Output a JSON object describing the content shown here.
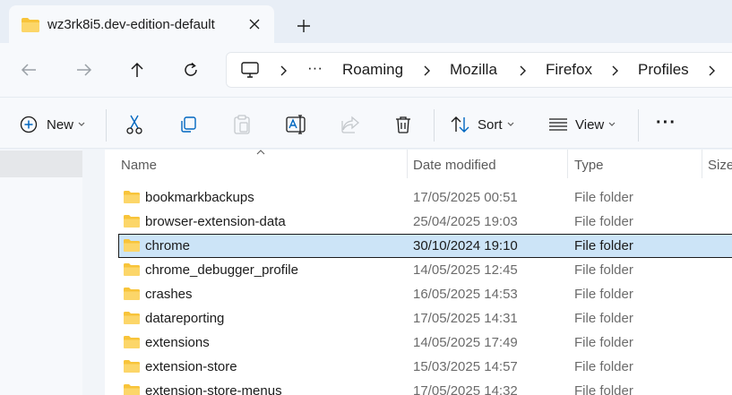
{
  "tab": {
    "title": "wz3rk8i5.dev-edition-default"
  },
  "breadcrumb": [
    "Roaming",
    "Mozilla",
    "Firefox",
    "Profiles"
  ],
  "breadcrumb_overflow": "···",
  "toolbar": {
    "new_label": "New",
    "sort_label": "Sort",
    "view_label": "View",
    "more_label": "···"
  },
  "columns": {
    "name": "Name",
    "date": "Date modified",
    "type": "Type",
    "size": "Size"
  },
  "rows": [
    {
      "name": "bookmarkbackups",
      "date": "17/05/2025 00:51",
      "type": "File folder"
    },
    {
      "name": "browser-extension-data",
      "date": "25/04/2025 19:03",
      "type": "File folder"
    },
    {
      "name": "chrome",
      "date": "30/10/2024 19:10",
      "type": "File folder",
      "selected": true
    },
    {
      "name": "chrome_debugger_profile",
      "date": "14/05/2025 12:45",
      "type": "File folder"
    },
    {
      "name": "crashes",
      "date": "16/05/2025 14:53",
      "type": "File folder"
    },
    {
      "name": "datareporting",
      "date": "17/05/2025 14:31",
      "type": "File folder"
    },
    {
      "name": "extensions",
      "date": "14/05/2025 17:49",
      "type": "File folder"
    },
    {
      "name": "extension-store",
      "date": "15/03/2025 14:57",
      "type": "File folder"
    },
    {
      "name": "extension-store-menus",
      "date": "17/05/2025 14:32",
      "type": "File folder"
    }
  ],
  "colors": {
    "accent": "#0067c0",
    "folder": "#f8c43a",
    "selection": "#cce4f7"
  },
  "icons": {
    "tab": "folder-icon",
    "close": "close-icon",
    "add": "plus-icon",
    "back": "back-arrow-icon",
    "forward": "forward-arrow-icon",
    "up": "up-arrow-icon",
    "refresh": "refresh-icon",
    "pc": "this-pc-icon",
    "cut": "cut-icon",
    "copy": "copy-icon",
    "paste": "paste-icon",
    "rename": "rename-icon",
    "share": "share-icon",
    "delete": "delete-icon",
    "sort": "sort-icon",
    "view": "view-icon"
  }
}
